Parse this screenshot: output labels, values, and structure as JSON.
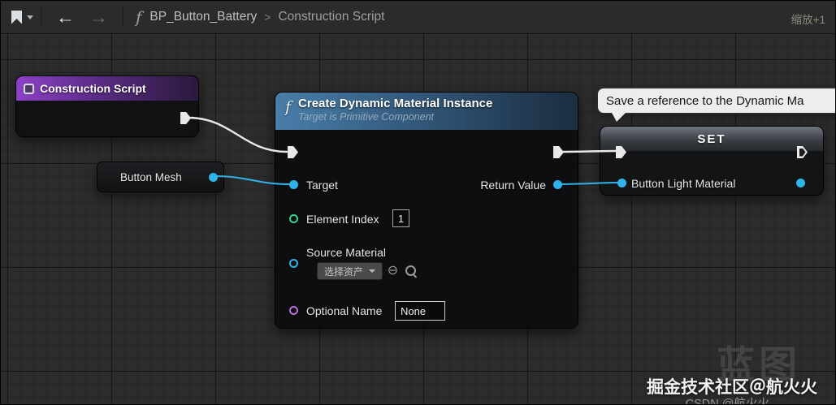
{
  "toolbar": {
    "fn_glyph": "f",
    "breadcrumb_root": "BP_Button_Battery",
    "breadcrumb_sep": ">",
    "breadcrumb_current": "Construction Script",
    "zoom_label": "缩放+1"
  },
  "graph": {
    "construction_script": {
      "title": "Construction Script"
    },
    "button_mesh": {
      "label": "Button Mesh"
    },
    "create_dmi": {
      "fn_glyph": "f",
      "title": "Create Dynamic Material Instance",
      "subtitle": "Target is Primitive Component",
      "target_label": "Target",
      "return_value_label": "Return Value",
      "element_index_label": "Element Index",
      "element_index_value": "1",
      "source_material_label": "Source Material",
      "asset_picker_label": "选择资产",
      "optional_name_label": "Optional Name",
      "optional_name_value": "None"
    },
    "set_node": {
      "title": "SET",
      "pin_label": "Button Light Material"
    },
    "comment_bubble": {
      "text": "Save a reference to the Dynamic Ma"
    }
  },
  "watermarks": {
    "large": "蓝图",
    "line1": "掘金技术社区＠航火火",
    "line2": "CSDN @航火火"
  },
  "colors": {
    "exec_wire": "#e8e8e8",
    "data_wire": "#2fb3e8",
    "pin_object": "#2fb3e8",
    "pin_int": "#2fd48f",
    "pin_name": "#b76fd9",
    "header_event": "#8d41c8",
    "header_function": "#497ea9",
    "graph_background": "#2c2c2c"
  }
}
